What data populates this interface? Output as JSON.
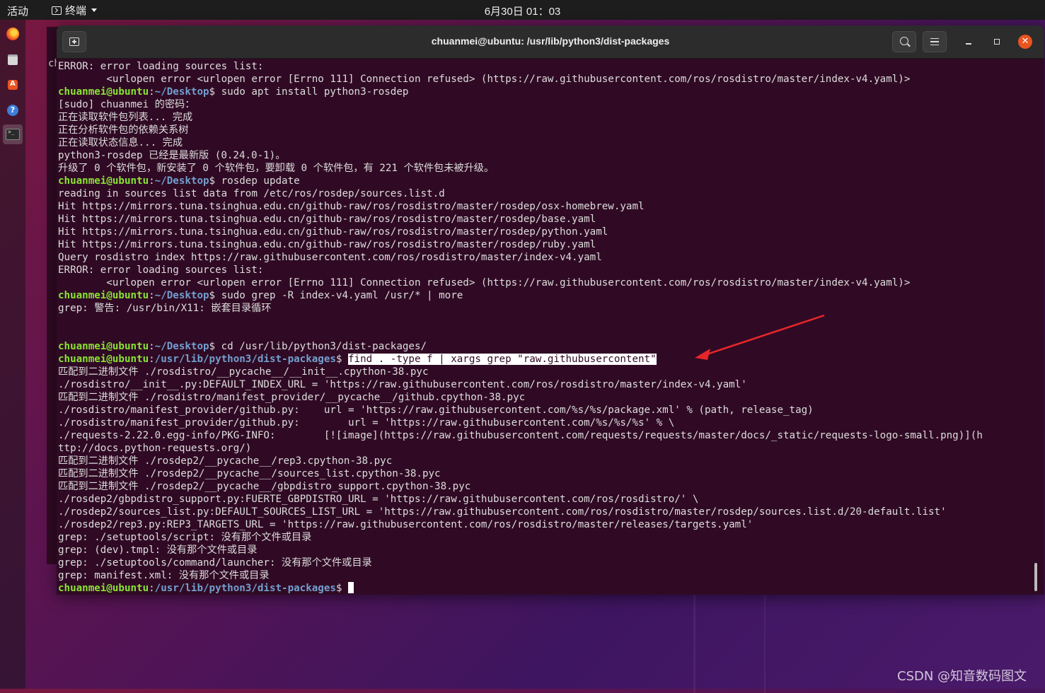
{
  "topbar": {
    "activities": "活动",
    "app_name": "终端",
    "clock": "6月30日 01：03"
  },
  "dock": {
    "items": [
      "firefox-icon",
      "files-icon",
      "software-icon",
      "help-icon",
      "terminal-icon"
    ]
  },
  "background_window": {
    "visible_text": "ch"
  },
  "window": {
    "title": "chuanmei@ubuntu: /usr/lib/python3/dist-packages"
  },
  "terminal": {
    "lines": [
      {
        "type": "text",
        "text": "ERROR: error loading sources list:"
      },
      {
        "type": "text",
        "text": "        <urlopen error <urlopen error [Errno 111] Connection refused> (https://raw.githubusercontent.com/ros/rosdistro/master/index-v4.yaml)>"
      },
      {
        "type": "prompt",
        "user": "chuanmei@ubuntu",
        "path": "~/Desktop",
        "cmd": " sudo apt install python3-rosdep"
      },
      {
        "type": "text",
        "text": "[sudo] chuanmei 的密码："
      },
      {
        "type": "text",
        "text": "正在读取软件包列表... 完成"
      },
      {
        "type": "text",
        "text": "正在分析软件包的依赖关系树"
      },
      {
        "type": "text",
        "text": "正在读取状态信息... 完成"
      },
      {
        "type": "text",
        "text": "python3-rosdep 已经是最新版 (0.24.0-1)。"
      },
      {
        "type": "text",
        "text": "升级了 0 个软件包，新安装了 0 个软件包，要卸载 0 个软件包，有 221 个软件包未被升级。"
      },
      {
        "type": "prompt",
        "user": "chuanmei@ubuntu",
        "path": "~/Desktop",
        "cmd": " rosdep update"
      },
      {
        "type": "text",
        "text": "reading in sources list data from /etc/ros/rosdep/sources.list.d"
      },
      {
        "type": "text",
        "text": "Hit https://mirrors.tuna.tsinghua.edu.cn/github-raw/ros/rosdistro/master/rosdep/osx-homebrew.yaml"
      },
      {
        "type": "text",
        "text": "Hit https://mirrors.tuna.tsinghua.edu.cn/github-raw/ros/rosdistro/master/rosdep/base.yaml"
      },
      {
        "type": "text",
        "text": "Hit https://mirrors.tuna.tsinghua.edu.cn/github-raw/ros/rosdistro/master/rosdep/python.yaml"
      },
      {
        "type": "text",
        "text": "Hit https://mirrors.tuna.tsinghua.edu.cn/github-raw/ros/rosdistro/master/rosdep/ruby.yaml"
      },
      {
        "type": "text",
        "text": "Query rosdistro index https://raw.githubusercontent.com/ros/rosdistro/master/index-v4.yaml"
      },
      {
        "type": "text",
        "text": "ERROR: error loading sources list:"
      },
      {
        "type": "text",
        "text": "        <urlopen error <urlopen error [Errno 111] Connection refused> (https://raw.githubusercontent.com/ros/rosdistro/master/index-v4.yaml)>"
      },
      {
        "type": "prompt",
        "user": "chuanmei@ubuntu",
        "path": "~/Desktop",
        "cmd": " sudo grep -R index-v4.yaml /usr/* | more"
      },
      {
        "type": "text",
        "text": "grep: 警告: /usr/bin/X11: 嵌套目录循环"
      },
      {
        "type": "text",
        "text": ""
      },
      {
        "type": "text",
        "text": ""
      },
      {
        "type": "prompt",
        "user": "chuanmei@ubuntu",
        "path": "~/Desktop",
        "cmd": " cd /usr/lib/python3/dist-packages/"
      },
      {
        "type": "prompt",
        "user": "chuanmei@ubuntu",
        "path": "/usr/lib/python3/dist-packages",
        "cmd": " ",
        "selected": "find . -type f | xargs grep \"raw.githubusercontent\""
      },
      {
        "type": "text",
        "text": "匹配到二进制文件 ./rosdistro/__pycache__/__init__.cpython-38.pyc"
      },
      {
        "type": "text",
        "text": "./rosdistro/__init__.py:DEFAULT_INDEX_URL = 'https://raw.githubusercontent.com/ros/rosdistro/master/index-v4.yaml'"
      },
      {
        "type": "text",
        "text": "匹配到二进制文件 ./rosdistro/manifest_provider/__pycache__/github.cpython-38.pyc"
      },
      {
        "type": "text",
        "text": "./rosdistro/manifest_provider/github.py:    url = 'https://raw.githubusercontent.com/%s/%s/package.xml' % (path, release_tag)"
      },
      {
        "type": "text",
        "text": "./rosdistro/manifest_provider/github.py:        url = 'https://raw.githubusercontent.com/%s/%s/%s' % \\"
      },
      {
        "type": "text",
        "text": "./requests-2.22.0.egg-info/PKG-INFO:        [![image](https://raw.githubusercontent.com/requests/requests/master/docs/_static/requests-logo-small.png)](h"
      },
      {
        "type": "text",
        "text": "ttp://docs.python-requests.org/)"
      },
      {
        "type": "text",
        "text": "匹配到二进制文件 ./rosdep2/__pycache__/rep3.cpython-38.pyc"
      },
      {
        "type": "text",
        "text": "匹配到二进制文件 ./rosdep2/__pycache__/sources_list.cpython-38.pyc"
      },
      {
        "type": "text",
        "text": "匹配到二进制文件 ./rosdep2/__pycache__/gbpdistro_support.cpython-38.pyc"
      },
      {
        "type": "text",
        "text": "./rosdep2/gbpdistro_support.py:FUERTE_GBPDISTRO_URL = 'https://raw.githubusercontent.com/ros/rosdistro/' \\"
      },
      {
        "type": "text",
        "text": "./rosdep2/sources_list.py:DEFAULT_SOURCES_LIST_URL = 'https://raw.githubusercontent.com/ros/rosdistro/master/rosdep/sources.list.d/20-default.list'"
      },
      {
        "type": "text",
        "text": "./rosdep2/rep3.py:REP3_TARGETS_URL = 'https://raw.githubusercontent.com/ros/rosdistro/master/releases/targets.yaml'"
      },
      {
        "type": "text",
        "text": "grep: ./setuptools/script: 没有那个文件或目录"
      },
      {
        "type": "text",
        "text": "grep: (dev).tmpl: 没有那个文件或目录"
      },
      {
        "type": "text",
        "text": "grep: ./setuptools/command/launcher: 没有那个文件或目录"
      },
      {
        "type": "text",
        "text": "grep: manifest.xml: 没有那个文件或目录"
      },
      {
        "type": "prompt",
        "user": "chuanmei@ubuntu",
        "path": "/usr/lib/python3/dist-packages",
        "cmd": " ",
        "cursor": true
      }
    ]
  },
  "watermark": "CSDN @知音数码图文",
  "colors": {
    "terminal_bg": "#300a24",
    "prompt_user": "#8ae234",
    "prompt_path": "#729fcf",
    "annotation_arrow": "#e8262a",
    "close_button": "#e95420"
  }
}
